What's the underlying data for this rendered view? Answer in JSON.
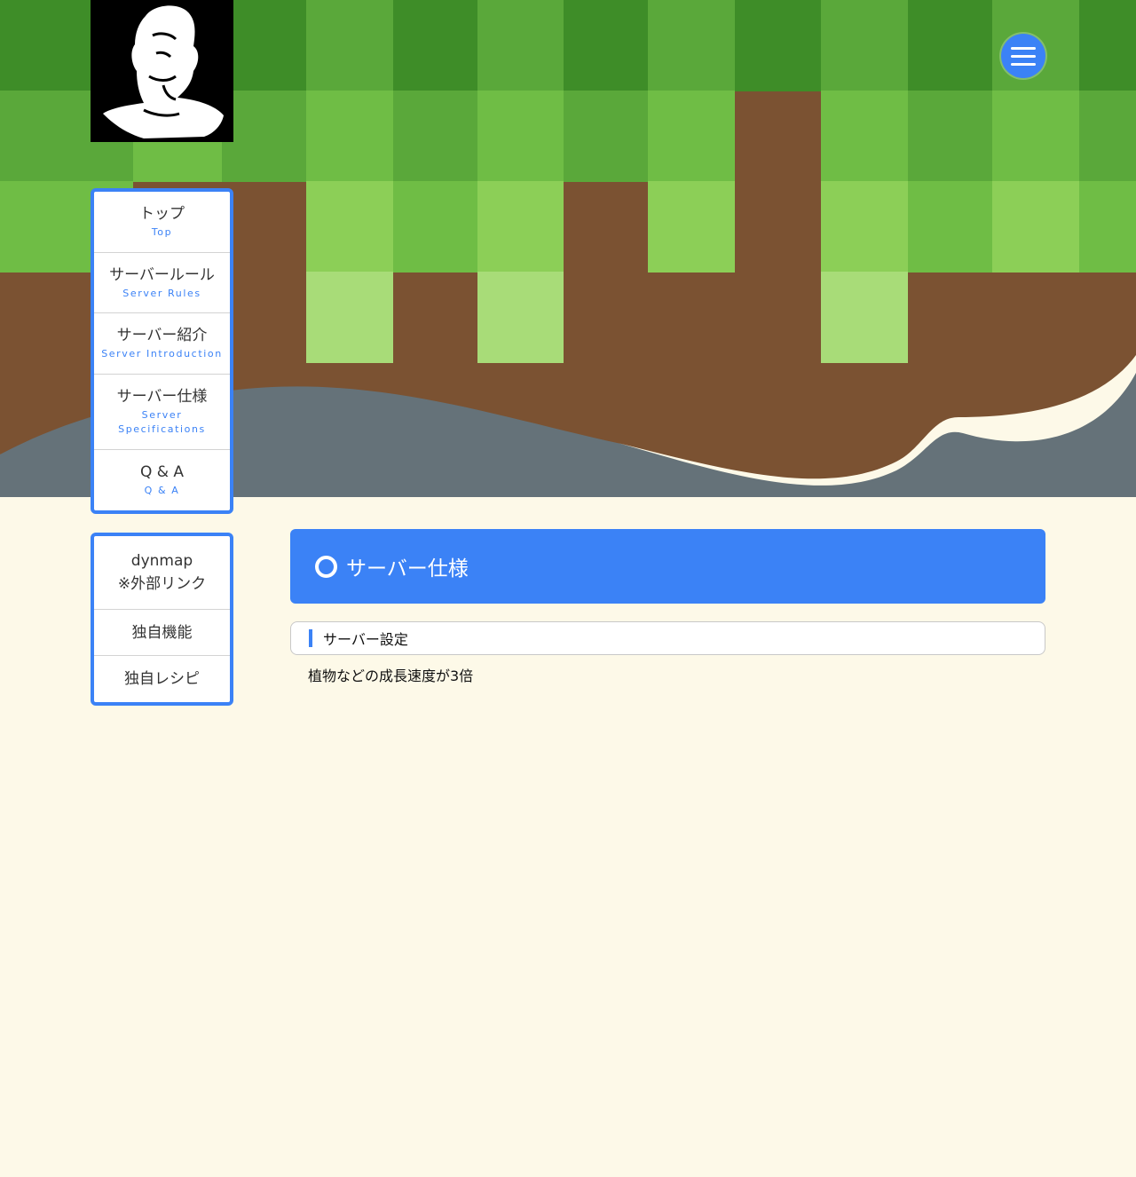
{
  "header": {
    "logo_alt": "logo",
    "menu_button": "hamburger-icon"
  },
  "nav_main": [
    {
      "jp": "トップ",
      "en": "Top"
    },
    {
      "jp": "サーバールール",
      "en": "Server Rules"
    },
    {
      "jp": "サーバー紹介",
      "en": "Server Introduction"
    },
    {
      "jp": "サーバー仕様",
      "en": "Server Specifications"
    },
    {
      "jp": "Q & A",
      "en": "Q & A"
    }
  ],
  "nav_sub": [
    {
      "line1": "dynmap",
      "line2": "※外部リンク"
    },
    {
      "line1": "独自機能"
    },
    {
      "line1": "独自レシピ"
    }
  ],
  "main": {
    "title": "サーバー仕様",
    "section_heading": "サーバー設定",
    "body": "植物などの成長速度が3倍"
  },
  "colors": {
    "accent": "#3b82f6",
    "background": "#fdf9e8",
    "grass": "#5aa83a",
    "dirt": "#7b5232"
  }
}
